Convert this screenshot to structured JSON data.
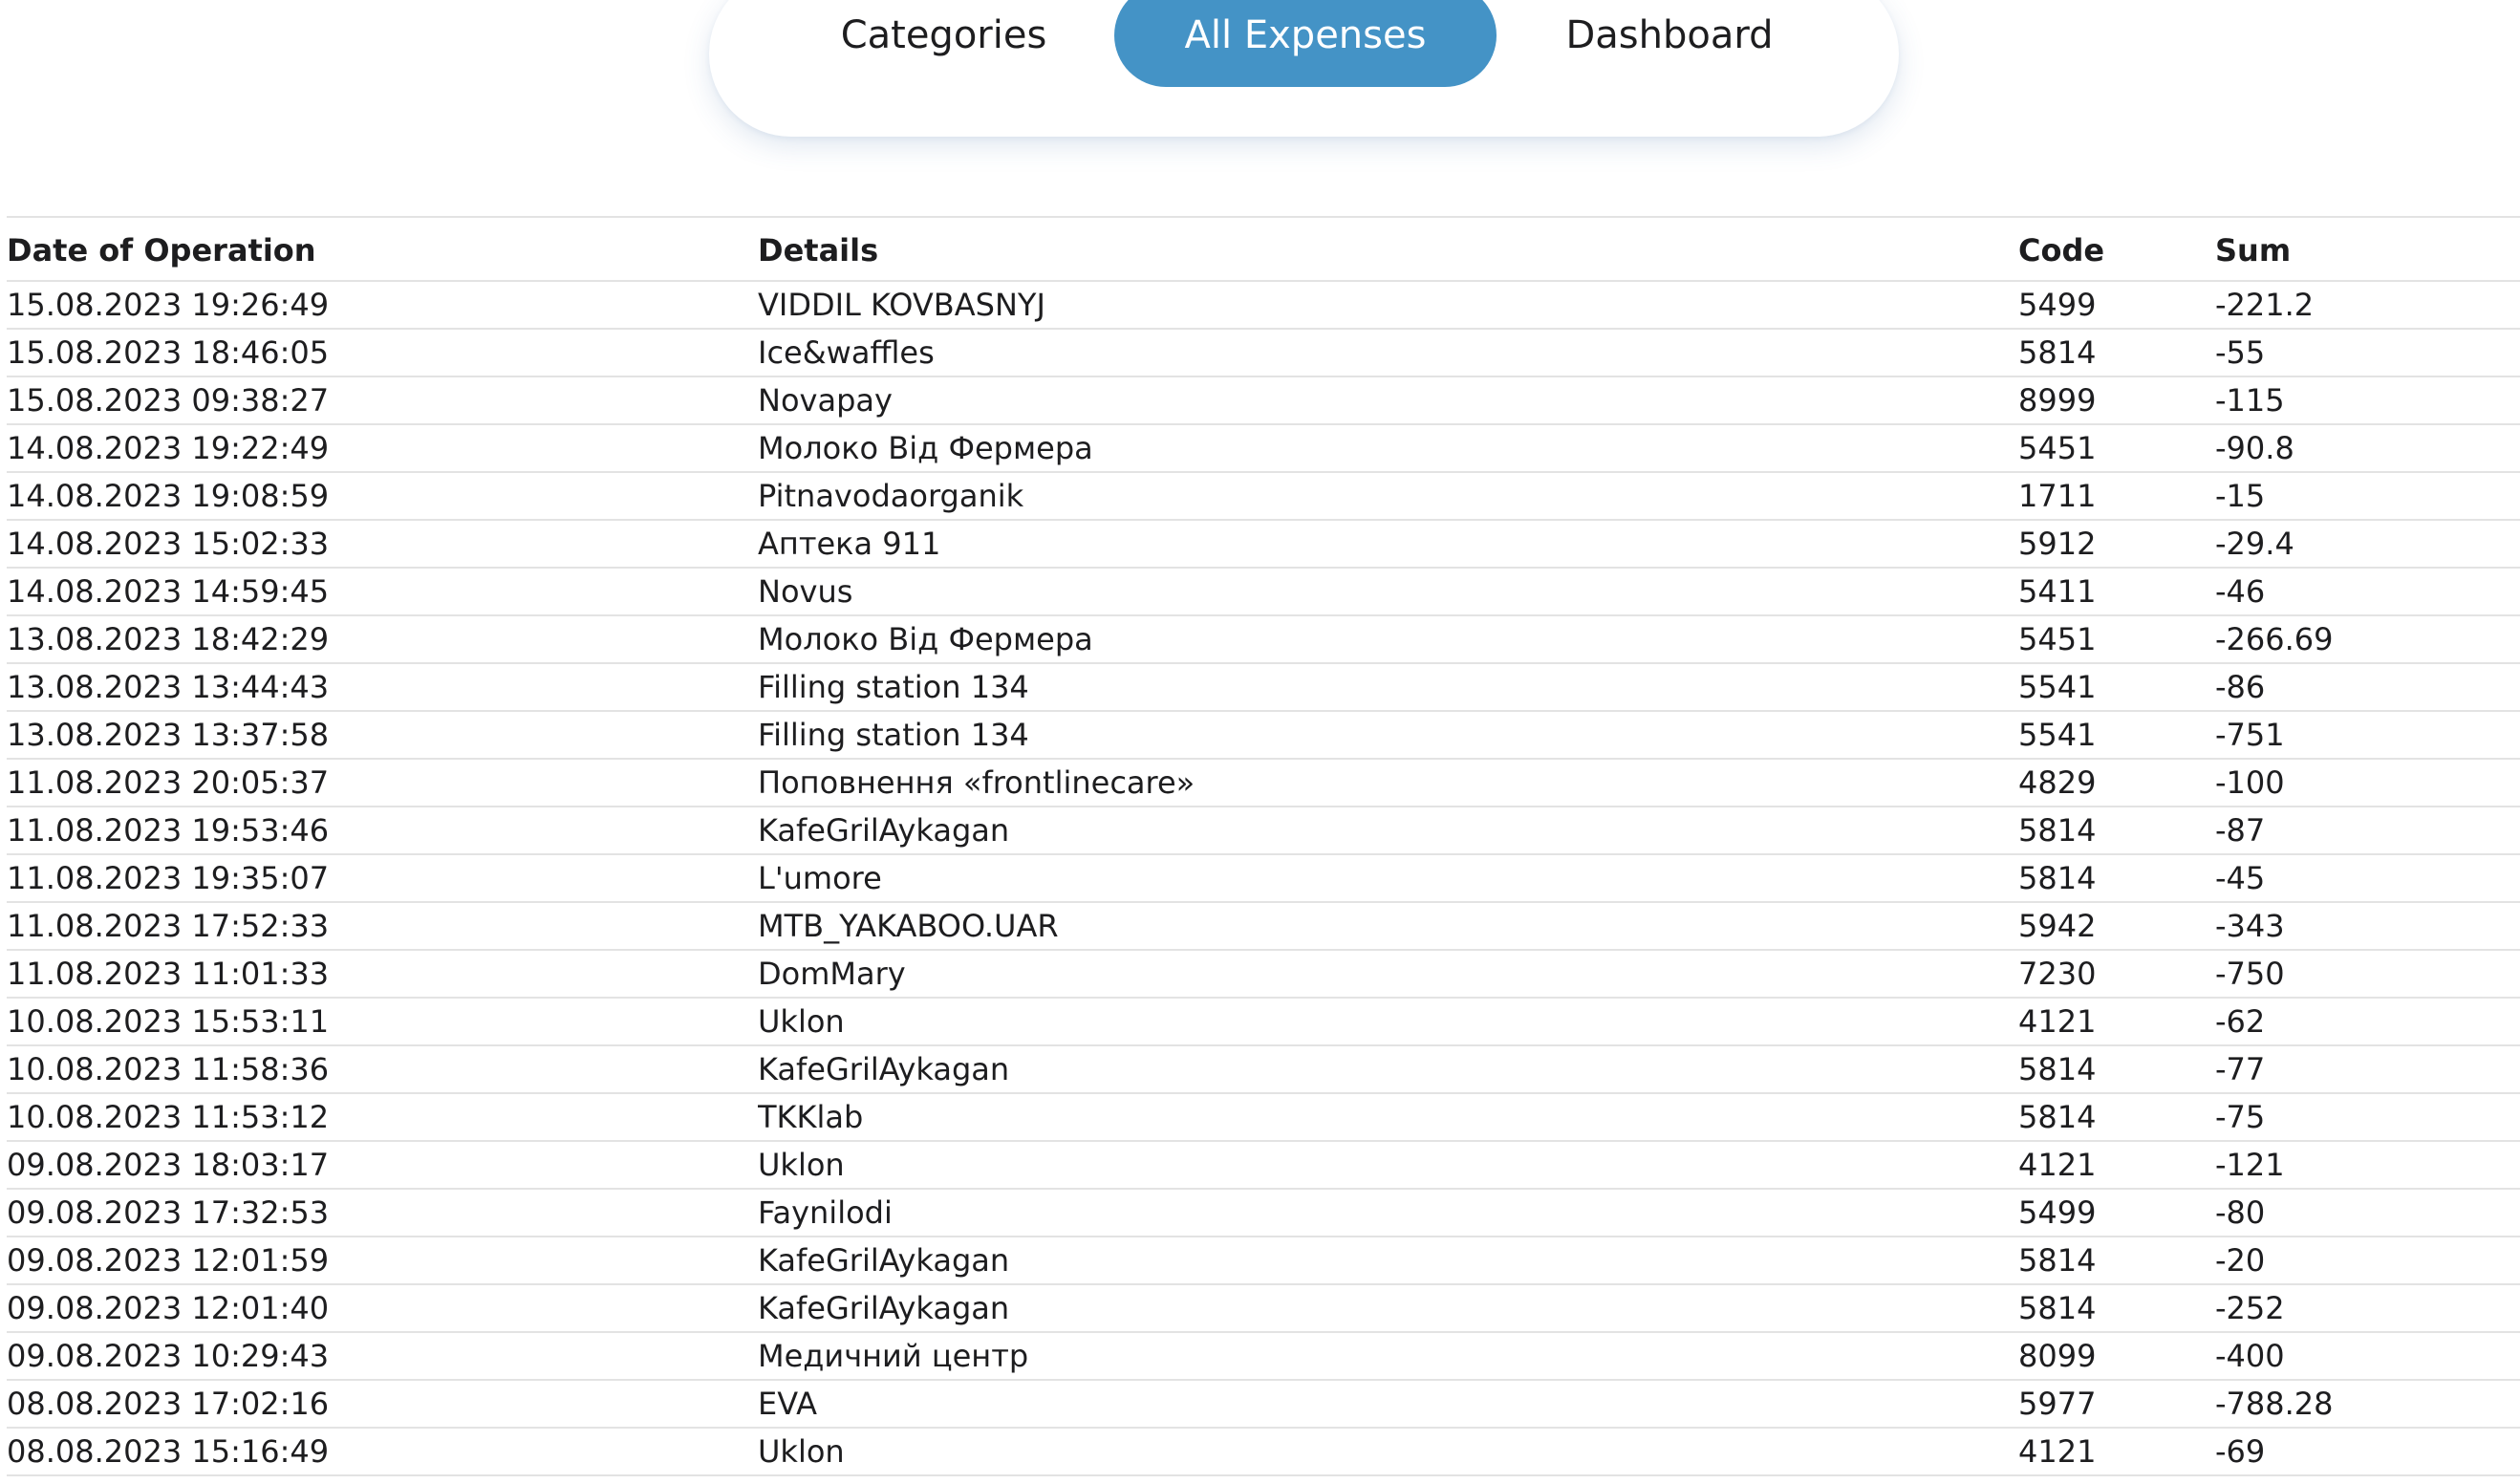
{
  "nav": {
    "tabs": [
      {
        "label": "Categories",
        "active": false
      },
      {
        "label": "All Expenses",
        "active": true
      },
      {
        "label": "Dashboard",
        "active": false
      }
    ],
    "active_color": "#4493c6"
  },
  "table": {
    "headers": {
      "date": "Date of Operation",
      "details": "Details",
      "code": "Code",
      "sum": "Sum"
    },
    "rows": [
      {
        "date": "15.08.2023 19:26:49",
        "details": "VIDDIL KOVBASNYJ",
        "code": "5499",
        "sum": "-221.2"
      },
      {
        "date": "15.08.2023 18:46:05",
        "details": "Ice&waffles",
        "code": "5814",
        "sum": "-55"
      },
      {
        "date": "15.08.2023 09:38:27",
        "details": "Novapay",
        "code": "8999",
        "sum": "-115"
      },
      {
        "date": "14.08.2023 19:22:49",
        "details": "Молоко Від Фермера",
        "code": "5451",
        "sum": "-90.8"
      },
      {
        "date": "14.08.2023 19:08:59",
        "details": "Pitnavodaorganik",
        "code": "1711",
        "sum": "-15"
      },
      {
        "date": "14.08.2023 15:02:33",
        "details": "Аптека 911",
        "code": "5912",
        "sum": "-29.4"
      },
      {
        "date": "14.08.2023 14:59:45",
        "details": "Novus",
        "code": "5411",
        "sum": "-46"
      },
      {
        "date": "13.08.2023 18:42:29",
        "details": "Молоко Від Фермера",
        "code": "5451",
        "sum": "-266.69"
      },
      {
        "date": "13.08.2023 13:44:43",
        "details": "Filling station 134",
        "code": "5541",
        "sum": "-86"
      },
      {
        "date": "13.08.2023 13:37:58",
        "details": "Filling station 134",
        "code": "5541",
        "sum": "-751"
      },
      {
        "date": "11.08.2023 20:05:37",
        "details": "Поповнення «frontlinecare»",
        "code": "4829",
        "sum": "-100"
      },
      {
        "date": "11.08.2023 19:53:46",
        "details": "KafeGrilAykagan",
        "code": "5814",
        "sum": "-87"
      },
      {
        "date": "11.08.2023 19:35:07",
        "details": "L'umore",
        "code": "5814",
        "sum": "-45"
      },
      {
        "date": "11.08.2023 17:52:33",
        "details": "MTB_YAKABOO.UAR",
        "code": "5942",
        "sum": "-343"
      },
      {
        "date": "11.08.2023 11:01:33",
        "details": "DomMary",
        "code": "7230",
        "sum": "-750"
      },
      {
        "date": "10.08.2023 15:53:11",
        "details": "Uklon",
        "code": "4121",
        "sum": "-62"
      },
      {
        "date": "10.08.2023 11:58:36",
        "details": "KafeGrilAykagan",
        "code": "5814",
        "sum": "-77"
      },
      {
        "date": "10.08.2023 11:53:12",
        "details": "TKKlab",
        "code": "5814",
        "sum": "-75"
      },
      {
        "date": "09.08.2023 18:03:17",
        "details": "Uklon",
        "code": "4121",
        "sum": "-121"
      },
      {
        "date": "09.08.2023 17:32:53",
        "details": "Faynilodi",
        "code": "5499",
        "sum": "-80"
      },
      {
        "date": "09.08.2023 12:01:59",
        "details": "KafeGrilAykagan",
        "code": "5814",
        "sum": "-20"
      },
      {
        "date": "09.08.2023 12:01:40",
        "details": "KafeGrilAykagan",
        "code": "5814",
        "sum": "-252"
      },
      {
        "date": "09.08.2023 10:29:43",
        "details": "Медичний центр",
        "code": "8099",
        "sum": "-400"
      },
      {
        "date": "08.08.2023 17:02:16",
        "details": "EVA",
        "code": "5977",
        "sum": "-788.28"
      },
      {
        "date": "08.08.2023 15:16:49",
        "details": "Uklon",
        "code": "4121",
        "sum": "-69"
      }
    ]
  }
}
